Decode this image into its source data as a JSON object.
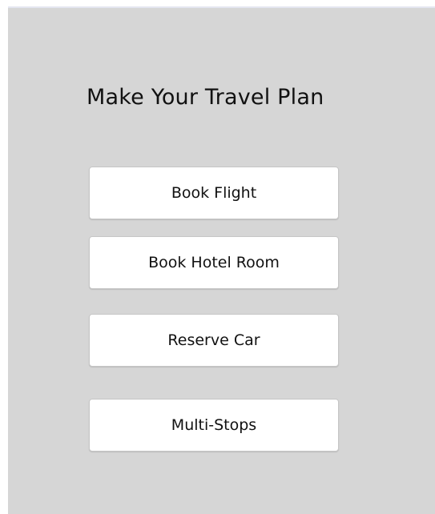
{
  "page": {
    "title": "Make Your Travel Plan"
  },
  "buttons": {
    "book_flight": "Book Flight",
    "book_hotel_room": "Book Hotel Room",
    "reserve_car": "Reserve Car",
    "multi_stops": "Multi-Stops"
  },
  "colors": {
    "background": "#d6d6d6",
    "button_background": "#ffffff",
    "button_border": "#c6c6c6",
    "text": "#111111"
  }
}
